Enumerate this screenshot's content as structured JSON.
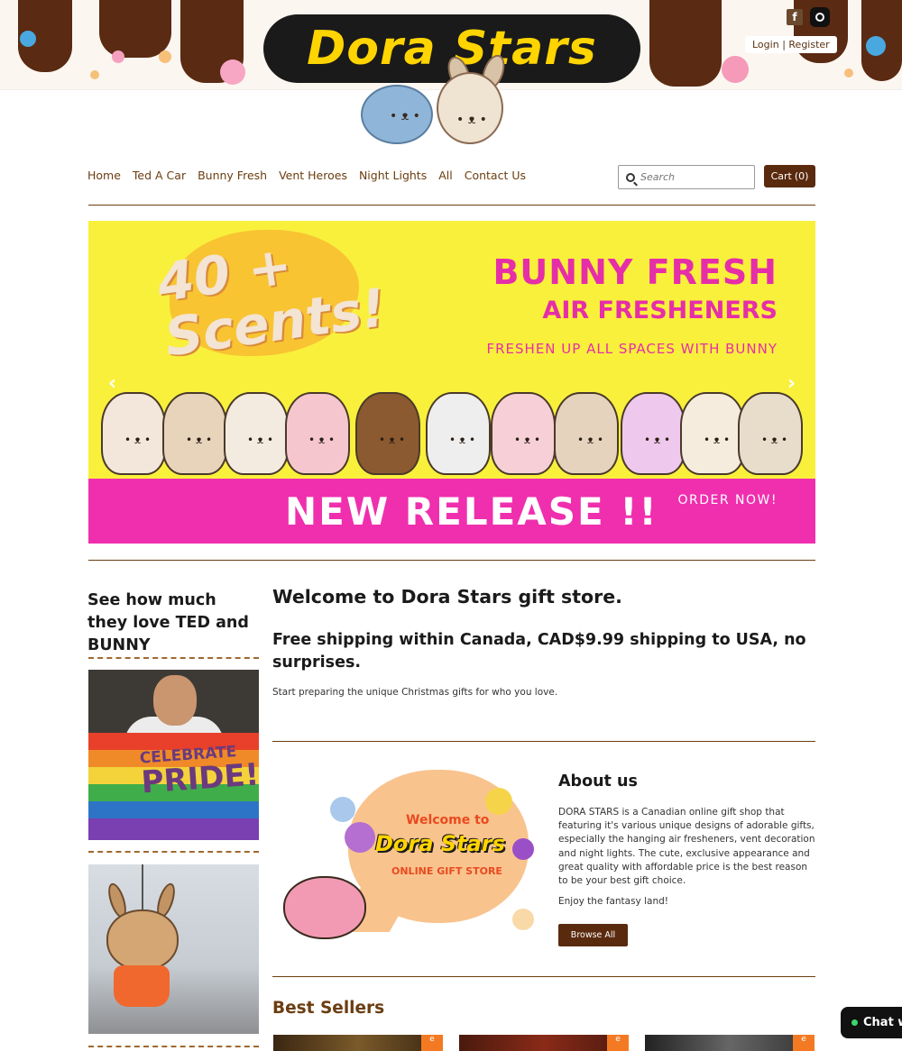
{
  "header": {
    "logo_text": "Dora Stars",
    "account": {
      "login": "Login",
      "separator": "|",
      "register": "Register"
    }
  },
  "nav": {
    "items": [
      "Home",
      "Ted A Car",
      "Bunny Fresh",
      "Vent Heroes",
      "Night Lights",
      "All",
      "Contact Us"
    ]
  },
  "search": {
    "placeholder": "Search"
  },
  "cart": {
    "label": "Cart",
    "count": "(0)"
  },
  "banner": {
    "scents_line1": "40 +",
    "scents_line2": "Scents!",
    "title_line1": "BUNNY FRESH",
    "title_line2": "AIR FRESHENERS",
    "tagline": "FRESHEN UP ALL SPACES WITH BUNNY",
    "release": "NEW RELEASE !!",
    "order_now": "ORDER NOW!",
    "prev_icon": "‹",
    "next_icon": "›"
  },
  "sidebar": {
    "title": "See how much they love TED and BUNNY",
    "photo1_text_small": "CELEBRATE",
    "photo1_text_big": "PRIDE!"
  },
  "main": {
    "welcome": "Welcome to Dora Stars gift store.",
    "shipping": "Free shipping within Canada, CAD$9.99 shipping to USA, no surprises.",
    "prep": "Start preparing the unique Christmas gifts for who you love."
  },
  "welcome_art": {
    "line1": "Welcome to",
    "line2": "Dora Stars",
    "line3": "ONLINE GIFT STORE"
  },
  "about": {
    "title": "About us",
    "body": "DORA STARS is a Canadian online gift shop that featuring it's various unique designs of adorable gifts, especially the hanging air fresheners, vent decoration and night lights. The cute, exclusive appearance and great quality with affordable price is the best reason to be your best gift choice.",
    "fantasy": "Enjoy the fantasy land!",
    "browse": "Browse All"
  },
  "best_sellers": {
    "title": "Best Sellers",
    "tag": "e"
  },
  "chat": {
    "label": "Chat w"
  },
  "colors": {
    "brown": "#5a2a0e",
    "nav_text": "#6b3d10",
    "banner_yellow": "#f9f03c",
    "banner_pink": "#ef2fae",
    "logo_yellow": "#ffd400"
  }
}
